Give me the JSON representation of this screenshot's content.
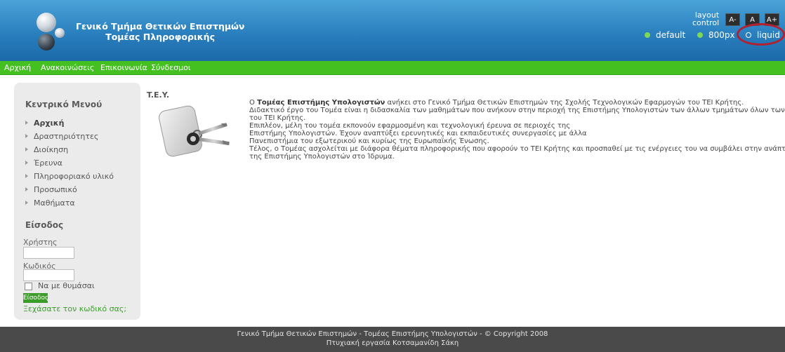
{
  "header": {
    "title_line1": "Γενικό Τμήμα Θετικών Επιστημών",
    "title_line2": "Τομέας Πληροφορικής",
    "layout_label_1": "layout",
    "layout_label_2": "control",
    "font_buttons": [
      "A-",
      "A",
      "A+"
    ],
    "layout_options": [
      "default",
      "800px",
      "liquid"
    ],
    "selected_layout": "liquid",
    "highlight_color": "#b22030"
  },
  "nav": {
    "items": [
      "Αρχική",
      "Ανακοινώσεις",
      "Επικοινωνία",
      "Σύνδεσμοι"
    ],
    "color": "#44c021"
  },
  "sidebar": {
    "menu_title": "Κεντρικό Μενού",
    "menu_items": [
      "Αρχική",
      "Δραστηριότητες",
      "Διοίκηση",
      "Έρευνα",
      "Πληροφοριακό υλικό",
      "Προσωπικό",
      "Μαθήματα"
    ],
    "login_title": "Είσοδος",
    "username_label": "Χρήστης",
    "password_label": "Κωδικός",
    "remember_label": "Να με θυμάσαι",
    "login_button": "Είσοδος",
    "forgot_link": "Ξεχάσατε τον κωδικό σας;"
  },
  "main": {
    "title": "T.E.Y.",
    "paragraph": {
      "line1_prefix": "Ο ",
      "line1_bold": "Τομέας Επιστήμης Υπολογιστών",
      "line1_suffix": " ανήκει στο Γενικό Τμήμα Θετικών Επιστημών της Σχολής Τεχνολογικών Εφαρμογών του ΤΕΙ Κρήτης.",
      "line2": "Διδακτικό έργο του Τομέα είναι η διδασκαλία των μαθημάτων που ανήκουν στην περιοχή της Επιστήμης Υπολογιστών των άλλων τμημάτων όλων των σχολών",
      "line3": "του ΤΕΙ Κρήτης.",
      "line4": "Επιπλέον, μέλη του τομέα εκπονούν εφαρμοσμένη και τεχνολογική έρευνα σε περιοχές της",
      "line5": "Επιστήμης Υπολογιστών. Έχουν αναπτύξει ερευνητικές και εκπαιδευτικές συνεργασίες με άλλα",
      "line6": "Πανεπιστήμια του εξωτερικού και κυρίως της Ευρωπαϊκής Ένωσης.",
      "line7": "Τέλος, ο Τομέας ασχολείται με διάφορα θέματα πληροφορικής που αφορούν το ΤΕΙ Κρήτης και προσπαθεί με τις ενέργειες του να συμβάλει στην ανάπτυξη",
      "line8": "της Επιστήμης Υπολογιστών στο Ίδρυμα."
    }
  },
  "footer": {
    "line1": "Γενικό Τμήμα Θετικών Επιστημών - Τομέας Επιστήμης Υπολογιστών - © Copyright 2008",
    "line2": "Πτυχιακή εργασία Κοτσαμανίδη Σάκη"
  }
}
